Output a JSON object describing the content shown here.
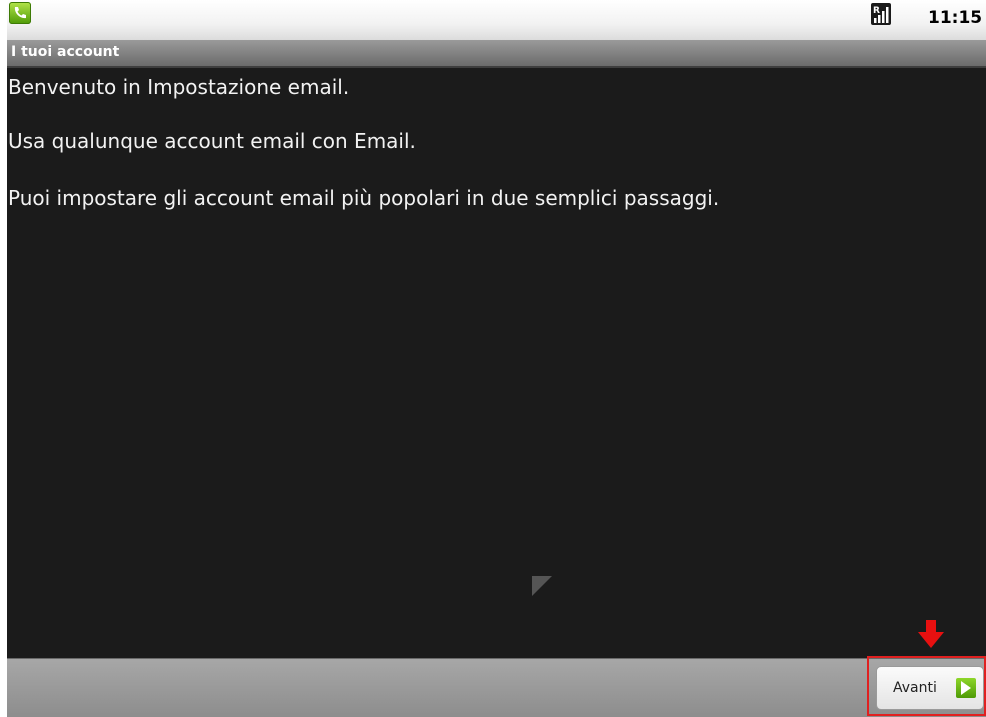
{
  "status_bar": {
    "time": "11:15",
    "icons": [
      "phone-icon",
      "signal-icon"
    ]
  },
  "title_bar": {
    "title": "I tuoi account"
  },
  "content": {
    "welcome": "Benvenuto in Impostazione email.",
    "line2": "Usa qualunque account email con Email.",
    "line3": "Puoi impostare gli account email più popolari in due semplici passaggi."
  },
  "bottom_bar": {
    "next_label": "Avanti",
    "next_icon": "arrow-right-icon"
  },
  "colors": {
    "highlight": "#e02020",
    "background": "#1b1b1b",
    "accent": "#6cc416"
  }
}
